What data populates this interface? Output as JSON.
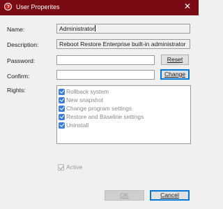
{
  "window": {
    "title": "User Properites",
    "close_glyph": "✕"
  },
  "form": {
    "name": {
      "label": "Name:",
      "value": "Administrator"
    },
    "description": {
      "label": "Description:",
      "value": "Reboot Restore Enterprise built-in administrator"
    },
    "password": {
      "label": "Password:",
      "value": "",
      "button": "Reset"
    },
    "confirm": {
      "label": "Confirm:",
      "value": "",
      "button": "Change"
    },
    "rights": {
      "label": "Rights:",
      "items": [
        {
          "label": "Rollback system",
          "checked": true
        },
        {
          "label": "New snapshot",
          "checked": true
        },
        {
          "label": "Change program settings",
          "checked": true
        },
        {
          "label": "Restore and Baseline settings",
          "checked": true
        },
        {
          "label": "Uninstall",
          "checked": true
        }
      ]
    },
    "active": {
      "label": "Active",
      "checked": true
    }
  },
  "buttons": {
    "ok": "OK",
    "cancel": "Cancel"
  },
  "colors": {
    "titlebar": "#7a0a14",
    "checkbox": "#3d7fd4",
    "default_button_border": "#0078d7"
  },
  "icons": {
    "app": "reboot-restore-icon",
    "close": "close-icon"
  }
}
